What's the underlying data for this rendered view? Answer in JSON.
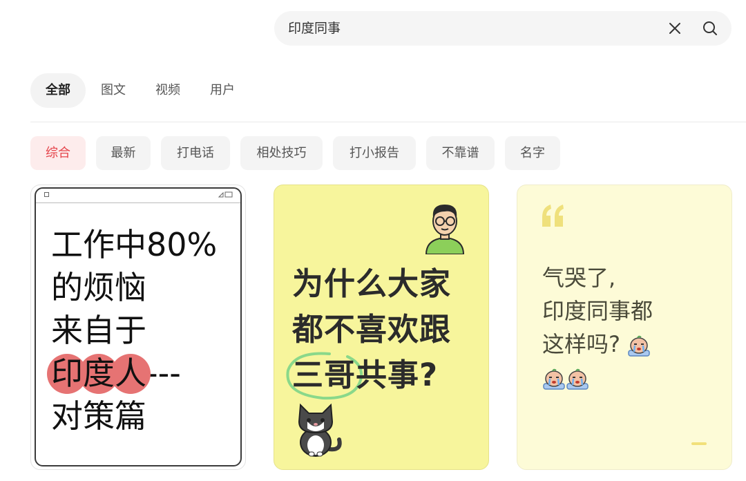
{
  "search": {
    "query": "印度同事"
  },
  "tabs": [
    {
      "label": "全部",
      "active": true
    },
    {
      "label": "图文",
      "active": false
    },
    {
      "label": "视频",
      "active": false
    },
    {
      "label": "用户",
      "active": false
    }
  ],
  "filters": [
    {
      "label": "综合",
      "active": true
    },
    {
      "label": "最新",
      "active": false
    },
    {
      "label": "打电话",
      "active": false
    },
    {
      "label": "相处技巧",
      "active": false
    },
    {
      "label": "打小报告",
      "active": false
    },
    {
      "label": "不靠谱",
      "active": false
    },
    {
      "label": "名字",
      "active": false
    }
  ],
  "cards": [
    {
      "lines": [
        "工作中80%",
        "的烦恼",
        "来自于"
      ],
      "highlight": [
        "印",
        "度",
        "人"
      ],
      "suffix": "---",
      "last_line": "对策篇"
    },
    {
      "lines": [
        "为什么大家",
        "都不喜欢跟",
        "三哥共事?"
      ]
    },
    {
      "lines": [
        "气哭了,",
        "印度同事都",
        "这样吗?"
      ]
    }
  ],
  "colors": {
    "accent": "#e5434a",
    "card2_bg": "#f7f59c",
    "card3_bg": "#fdfbd7",
    "highlight": "#e67373"
  },
  "icons": {
    "clear": "close-icon",
    "search": "search-icon",
    "quote": "quote-icon",
    "crying": "crying-emoji"
  }
}
